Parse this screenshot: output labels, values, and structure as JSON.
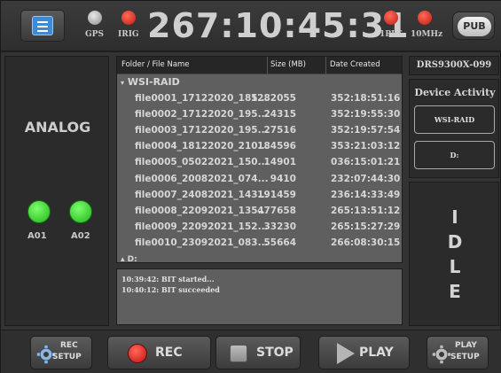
{
  "top_bar": {
    "clock": "267:10:45:31",
    "indicators": [
      {
        "label": "GPS",
        "status": "inactive",
        "color": "#a8a8a8"
      },
      {
        "label": "IRIG",
        "status": "alarm",
        "color": "#e0261a"
      },
      {
        "label": "1PPS",
        "status": "alarm",
        "color": "#e0261a"
      },
      {
        "label": "10MHz",
        "status": "alarm",
        "color": "#e0261a"
      }
    ],
    "menu_icon": "menu-list-icon",
    "pub_label": "PUB"
  },
  "analog": {
    "title": "ANALOG",
    "channels": [
      {
        "label": "A01",
        "color": "#3fe23a"
      },
      {
        "label": "A02",
        "color": "#3fe23a"
      }
    ]
  },
  "file_table": {
    "columns": [
      "Folder / File Name",
      "Size (MB)",
      "Date Created"
    ],
    "groups": [
      {
        "name": "WSI-RAID",
        "files": [
          {
            "name": "file0001_17122020_185...",
            "size": "1282055",
            "date": "352:18:51:16"
          },
          {
            "name": "file0002_17122020_195...",
            "size": "24315",
            "date": "352:19:55:30"
          },
          {
            "name": "file0003_17122020_195...",
            "size": "27516",
            "date": "352:19:57:54"
          },
          {
            "name": "file0004_18122020_210...",
            "size": "184596",
            "date": "353:21:03:12"
          },
          {
            "name": "file0005_05022021_150...",
            "size": "14901",
            "date": "036:15:01:21"
          },
          {
            "name": "file0006_20082021_074...",
            "size": "9410",
            "date": "232:07:44:30"
          },
          {
            "name": "file0007_24082021_143...",
            "size": "191459",
            "date": "236:14:33:49"
          },
          {
            "name": "file0008_22092021_135...",
            "size": "477658",
            "date": "265:13:51:12"
          },
          {
            "name": "file0009_22092021_152...",
            "size": "33230",
            "date": "265:15:27:29"
          },
          {
            "name": "file0010_23092021_083...",
            "size": "55664",
            "date": "266:08:30:15"
          }
        ]
      },
      {
        "name": "D:",
        "files": []
      }
    ]
  },
  "log": {
    "lines": [
      "10:39:42: BIT started...",
      "10:40:12: BIT succeeded"
    ]
  },
  "device": {
    "id": "DRS9300X-099",
    "activity_title": "Device Activity",
    "drives": [
      "WSI-RAID",
      "D:"
    ],
    "status_letters": [
      "I",
      "D",
      "L",
      "E"
    ]
  },
  "bottom_bar": {
    "rec_setup": {
      "line1": "REC",
      "line2": "SETUP",
      "icon": "gear-icon"
    },
    "rec": {
      "label": "REC",
      "icon": "record-icon"
    },
    "stop": {
      "label": "STOP",
      "icon": "stop-icon"
    },
    "play": {
      "label": "PLAY",
      "icon": "play-icon"
    },
    "play_setup": {
      "line1": "PLAY",
      "line2": "SETUP",
      "icon": "gear-icon"
    }
  },
  "colors": {
    "accent_blue": "#3d8ad6",
    "led_red": "#e0261a",
    "led_green": "#3fe23a",
    "panel_bg": "#2b2b2b",
    "table_bg": "#5f5f5f"
  }
}
